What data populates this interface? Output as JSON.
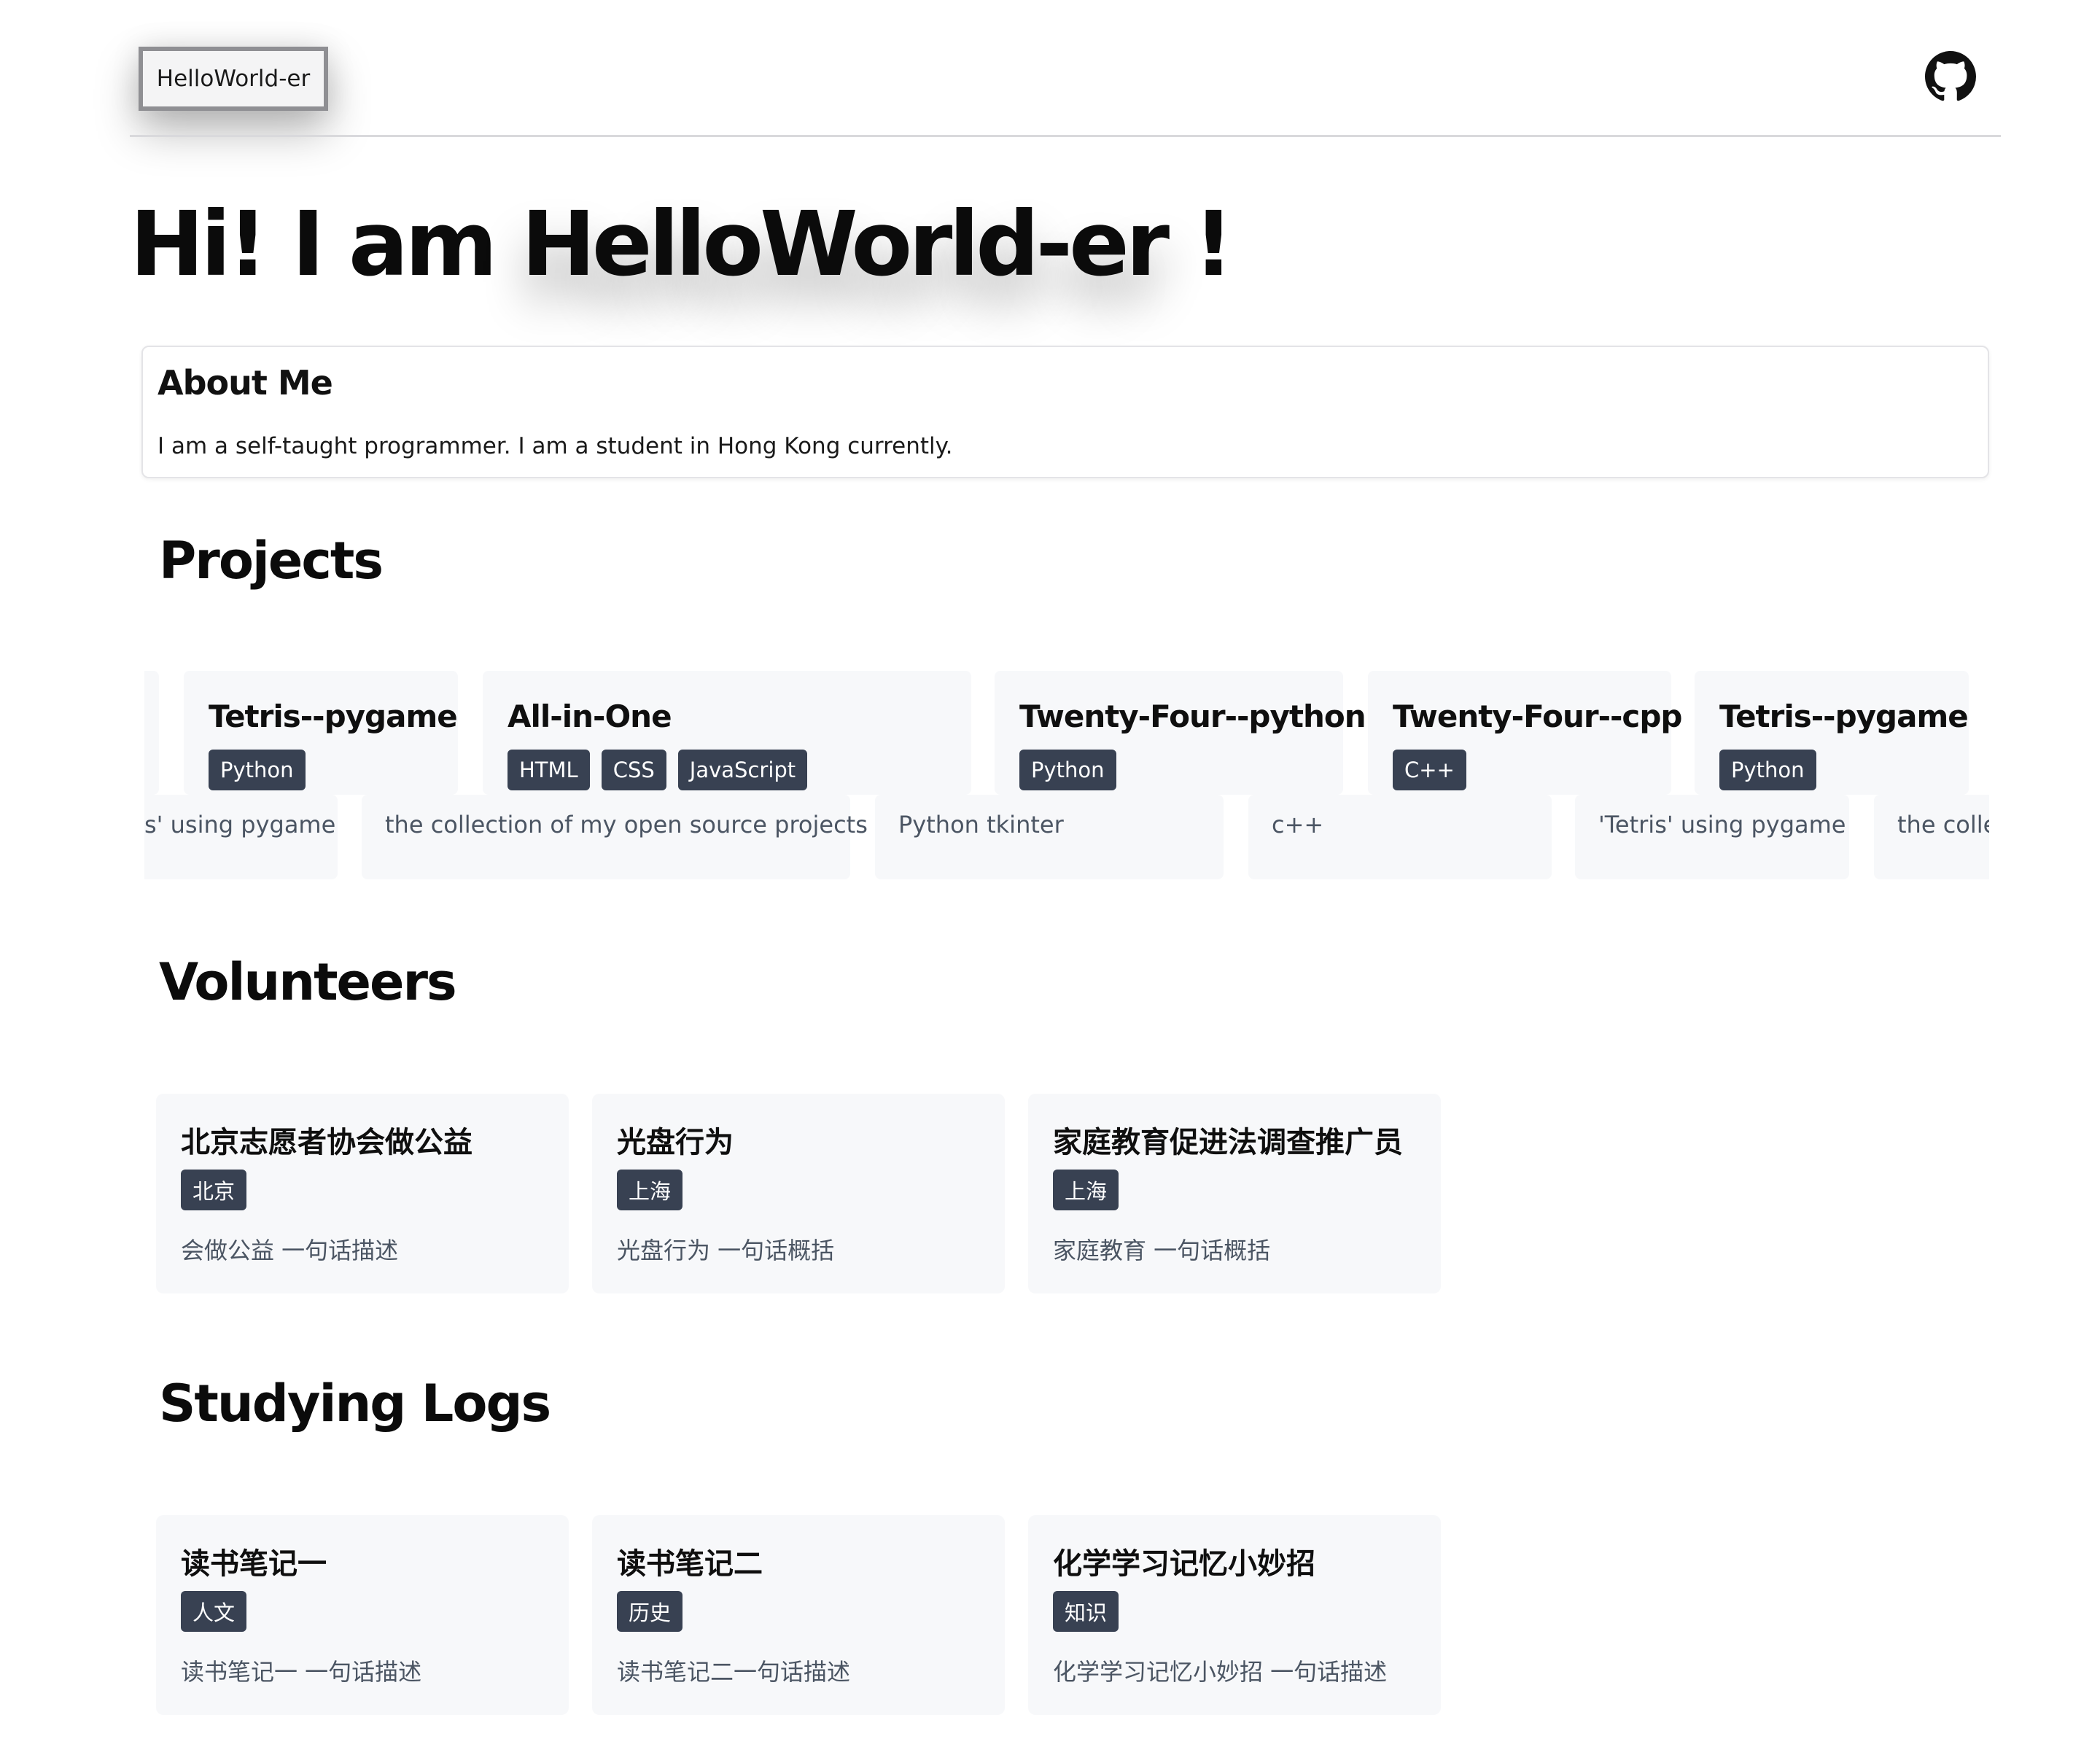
{
  "header": {
    "logo_label": "HelloWorld-er",
    "github_icon": "github-icon"
  },
  "hero": {
    "prefix": "Hi! I am ",
    "name": "HelloWorld-er",
    "suffix": " !"
  },
  "about": {
    "title": "About Me",
    "text": "I am a self-taught programmer. I am a student in Hong Kong currently."
  },
  "projects": {
    "title": "Projects",
    "partial_left_desc": "s' using pygame",
    "items": [
      {
        "title": "Tetris--pygame",
        "tags": [
          "Python"
        ]
      },
      {
        "title": "All-in-One",
        "tags": [
          "HTML",
          "CSS",
          "JavaScript"
        ]
      },
      {
        "title": "Twenty-Four--python",
        "tags": [
          "Python"
        ]
      },
      {
        "title": "Twenty-Four--cpp",
        "tags": [
          "C++"
        ]
      },
      {
        "title": "Tetris--pygame",
        "tags": [
          "Python"
        ]
      }
    ],
    "descriptions": [
      "the collection of my open source projects",
      "Python tkinter",
      "c++",
      "'Tetris' using pygame",
      "the colle"
    ]
  },
  "volunteers": {
    "title": "Volunteers",
    "items": [
      {
        "title": "北京志愿者协会做公益",
        "tag": "北京",
        "desc": "会做公益 一句话描述"
      },
      {
        "title": "光盘行为",
        "tag": "上海",
        "desc": "光盘行为 一句话概括"
      },
      {
        "title": "家庭教育促进法调查推广员",
        "tag": "上海",
        "desc": "家庭教育 一句话概括"
      }
    ]
  },
  "studying_logs": {
    "title": "Studying Logs",
    "items": [
      {
        "title": "读书笔记一",
        "tag": "人文",
        "desc": "读书笔记一 一句话描述"
      },
      {
        "title": "读书笔记二",
        "tag": "历史",
        "desc": "读书笔记二一句话描述"
      },
      {
        "title": "化学学习记忆小妙招",
        "tag": "知识",
        "desc": "化学学习记忆小妙招 一句话描述"
      }
    ]
  }
}
